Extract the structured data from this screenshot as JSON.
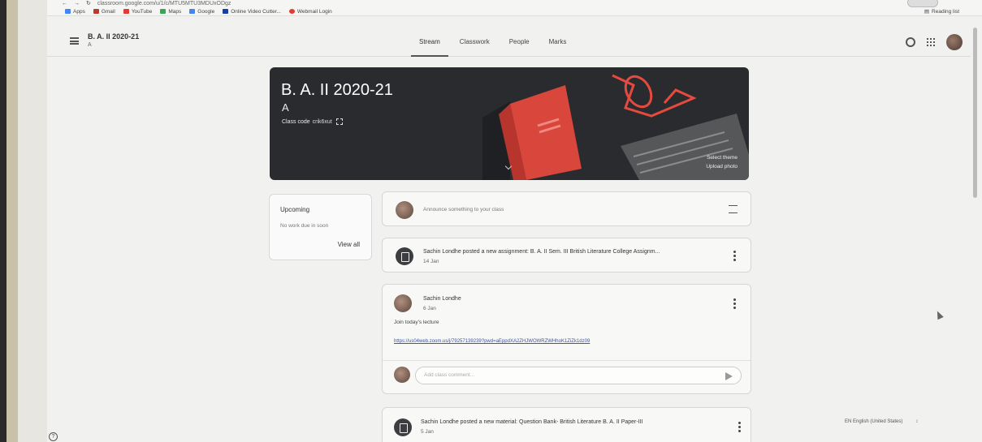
{
  "browser": {
    "url": "classroom.google.com/u/1/c/MTU5MTU3MDUxODgz",
    "bookmarks": [
      {
        "label": "Apps",
        "color": "#4285f4"
      },
      {
        "label": "Gmail",
        "color": "#444444"
      },
      {
        "label": "YouTube",
        "color": "#e53935"
      },
      {
        "label": "Maps",
        "color": "#34a853"
      },
      {
        "label": "Google",
        "color": "#4285f4"
      },
      {
        "label": "Online Video Cutter...",
        "color": "#1a3fa0"
      },
      {
        "label": "Webmail Login",
        "color": "#e53935"
      }
    ],
    "reading_list": "Reading list"
  },
  "header": {
    "class_title": "B. A. II 2020-21",
    "section": "A",
    "tabs": [
      {
        "label": "Stream",
        "active": true
      },
      {
        "label": "Classwork",
        "active": false
      },
      {
        "label": "People",
        "active": false
      },
      {
        "label": "Marks",
        "active": false
      }
    ],
    "icons": [
      "gear-icon",
      "apps-grid-icon",
      "avatar"
    ]
  },
  "banner": {
    "title": "B. A. II 2020-21",
    "section": "A",
    "class_code_label": "Class code",
    "class_code": "crik6xut",
    "select_theme": "Select theme",
    "upload_photo": "Upload photo"
  },
  "upcoming": {
    "title": "Upcoming",
    "text": "No work due in soon",
    "view_all": "View all"
  },
  "stream": {
    "announce_placeholder": "Announce something to your class",
    "posts": [
      {
        "type": "assignment",
        "text": "Sachin Londhe posted a new assignment: B. A. II Sem. III British Literature College Assignm...",
        "date": "14 Jan"
      },
      {
        "type": "announcement",
        "author": "Sachin Londhe",
        "date": "6 Jan",
        "body": "Join today's lecture",
        "link": "https://us04web.zoom.us/j/79257139239?pwd=aEppdXA2ZHJWOWRZWHhoK1ZiZk1dz09",
        "comment_placeholder": "Add class comment..."
      },
      {
        "type": "material",
        "text": "Sachin Londhe posted a new material: Question Bank- British Literature B. A. II Paper-III",
        "date": "5 Jan"
      }
    ]
  },
  "footer": {
    "language": "EN English (United States)",
    "help": "?"
  }
}
